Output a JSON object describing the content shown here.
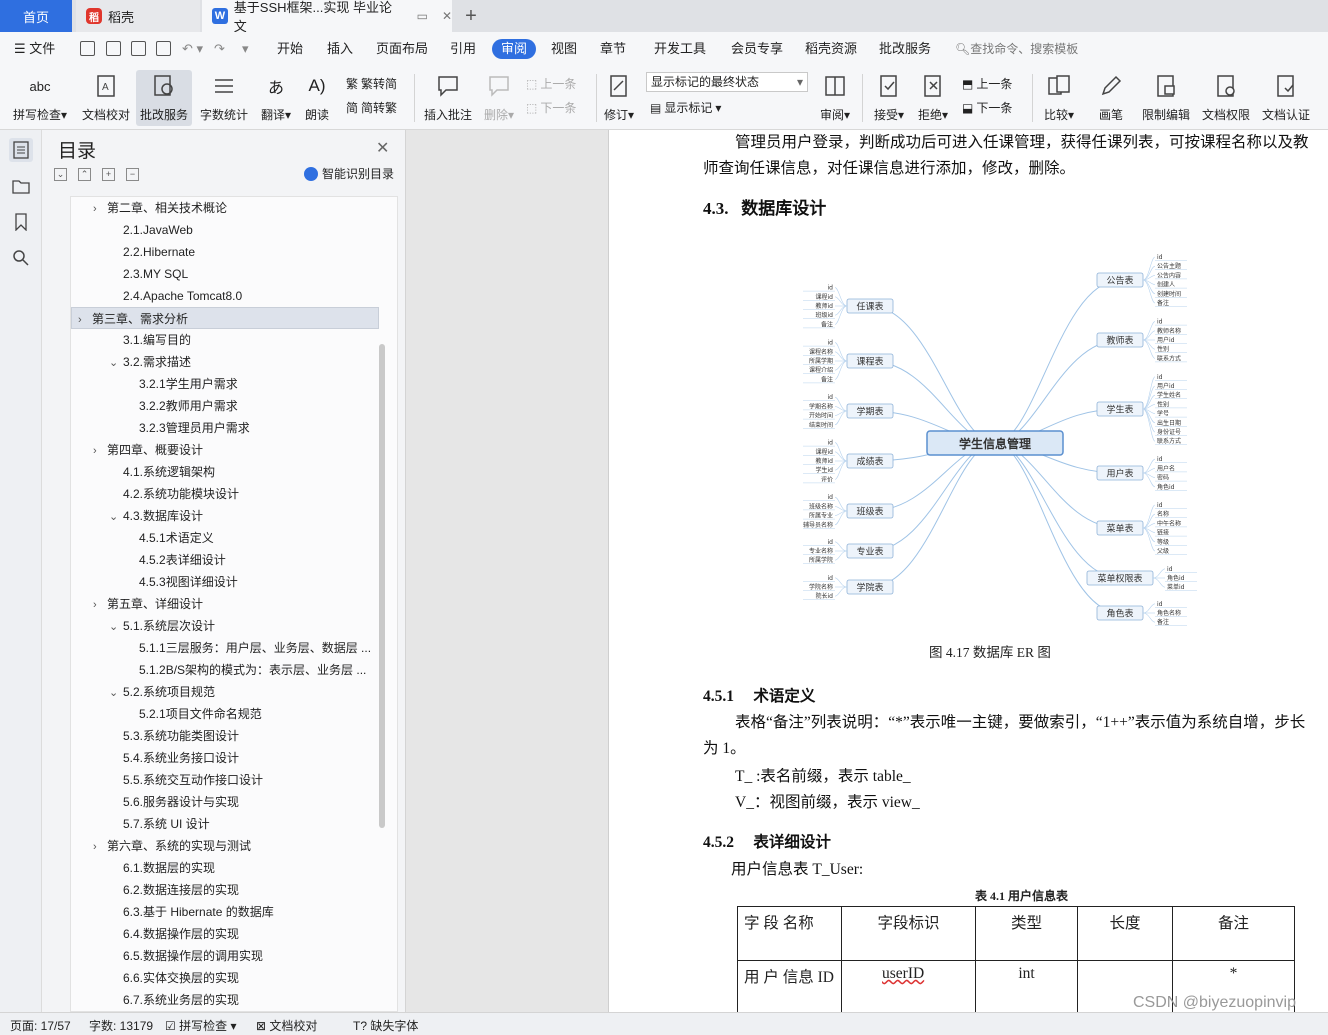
{
  "tabs": {
    "home": "首页",
    "daoke": "稻壳",
    "doc": "基于SSH框架...实现 毕业论文"
  },
  "menu": {
    "file": "文件",
    "items": [
      "开始",
      "插入",
      "页面布局",
      "引用",
      "审阅",
      "视图",
      "章节",
      "开发工具",
      "会员专享",
      "稻壳资源",
      "批改服务"
    ],
    "active": "审阅",
    "search": "查找命令、搜索模板"
  },
  "ribbon": {
    "spell": "拼写检查",
    "doccheck": "文档校对",
    "correct": "批改服务",
    "wordcount": "字数统计",
    "translate": "翻译",
    "read": "朗读",
    "trad": "繁转简",
    "simp": "简转繁",
    "insert_comment": "插入批注",
    "delete": "删除",
    "prev": "上一条",
    "next": "下一条",
    "track": "修订",
    "markup_state": "显示标记的最终状态",
    "show_markup": "显示标记",
    "review": "审阅",
    "accept": "接受",
    "reject": "拒绝",
    "prev2": "上一条",
    "next2": "下一条",
    "compare": "比较",
    "pen": "画笔",
    "restrict": "限制编辑",
    "perm": "文档权限",
    "cert": "文档认证",
    "abc": "abc"
  },
  "toc": {
    "title": "目录",
    "smart": "智能识别目录",
    "items": [
      {
        "text": "第二章、相关技术概论",
        "level": 1,
        "arrow": "›"
      },
      {
        "text": "2.1.JavaWeb",
        "level": 2,
        "arrow": ""
      },
      {
        "text": "2.2.Hibernate",
        "level": 2,
        "arrow": ""
      },
      {
        "text": "2.3.MY SQL",
        "level": 2,
        "arrow": ""
      },
      {
        "text": "2.4.Apache Tomcat8.0",
        "level": 2,
        "arrow": ""
      },
      {
        "text": "第三章、需求分析",
        "level": 0,
        "arrow": "›"
      },
      {
        "text": "3.1.编写目的",
        "level": 2,
        "arrow": ""
      },
      {
        "text": "3.2.需求描述",
        "level": 1.5,
        "arrow": "⌄"
      },
      {
        "text": "3.2.1学生用户需求",
        "level": 3,
        "arrow": ""
      },
      {
        "text": "3.2.2教师用户需求",
        "level": 3,
        "arrow": ""
      },
      {
        "text": "3.2.3管理员用户需求",
        "level": 3,
        "arrow": ""
      },
      {
        "text": "第四章、概要设计",
        "level": 1,
        "arrow": "›"
      },
      {
        "text": "4.1.系统逻辑架构",
        "level": 2,
        "arrow": ""
      },
      {
        "text": "4.2.系统功能模块设计",
        "level": 2,
        "arrow": ""
      },
      {
        "text": "4.3.数据库设计",
        "level": 1.5,
        "arrow": "⌄"
      },
      {
        "text": "4.5.1术语定义",
        "level": 3,
        "arrow": ""
      },
      {
        "text": "4.5.2表详细设计",
        "level": 3,
        "arrow": ""
      },
      {
        "text": "4.5.3视图详细设计",
        "level": 3,
        "arrow": ""
      },
      {
        "text": "第五章、详细设计",
        "level": 1,
        "arrow": "›"
      },
      {
        "text": "5.1.系统层次设计",
        "level": 1.5,
        "arrow": "⌄"
      },
      {
        "text": "5.1.1三层服务：用户层、业务层、数据层 ...",
        "level": 3,
        "arrow": ""
      },
      {
        "text": "5.1.2B/S架构的模式为：表示层、业务层 ...",
        "level": 3,
        "arrow": ""
      },
      {
        "text": "5.2.系统项目规范",
        "level": 1.5,
        "arrow": "⌄"
      },
      {
        "text": "5.2.1项目文件命名规范",
        "level": 3,
        "arrow": ""
      },
      {
        "text": "5.3.系统功能类图设计",
        "level": 2,
        "arrow": ""
      },
      {
        "text": "5.4.系统业务接口设计",
        "level": 2,
        "arrow": ""
      },
      {
        "text": "5.5.系统交互动作接口设计",
        "level": 2,
        "arrow": ""
      },
      {
        "text": "5.6.服务器设计与实现",
        "level": 2,
        "arrow": ""
      },
      {
        "text": "5.7.系统 UI 设计",
        "level": 2,
        "arrow": ""
      },
      {
        "text": "第六章、系统的实现与测试",
        "level": 1,
        "arrow": "›"
      },
      {
        "text": "6.1.数据层的实现",
        "level": 2,
        "arrow": ""
      },
      {
        "text": "6.2.数据连接层的实现",
        "level": 2,
        "arrow": ""
      },
      {
        "text": "6.3.基于 Hibernate 的数据库",
        "level": 2,
        "arrow": ""
      },
      {
        "text": "6.4.数据操作层的实现",
        "level": 2,
        "arrow": ""
      },
      {
        "text": "6.5.数据操作层的调用实现",
        "level": 2,
        "arrow": ""
      },
      {
        "text": "6.6.实体交换层的实现",
        "level": 2,
        "arrow": ""
      },
      {
        "text": "6.7.系统业务层的实现",
        "level": 2,
        "arrow": ""
      }
    ]
  },
  "doc": {
    "line1": "管理员用户登录，判断成功后可进入任课管理，获得任课列表，可按课程名称以及教",
    "line2": "师查询任课信息，对任课信息进行添加，修改，删除。",
    "h43_num": "4.3.",
    "h43": "数据库设计",
    "fig_caption": "图 4.17 数据库 ER 图",
    "h451_num": "4.5.1",
    "h451": "术语定义",
    "p1a": "表格“备注”列表说明：“*”表示唯一主键，要做索引，“1++”表示值为系统自增，步长",
    "p1b": "为 1。",
    "p2": "T_ :表名前缀，表示 table_",
    "p3": "V_：视图前缀，表示 view_",
    "h452_num": "4.5.2",
    "h452": "表详细设计",
    "p4": "用户信息表 T_User:",
    "table_caption": "表 4.1  用户信息表",
    "table_headers": [
      "字 段 名称",
      "字段标识",
      "类型",
      "长度",
      "备注"
    ],
    "table_rows": [
      [
        "用 户 信息 ID",
        "userID",
        "int",
        "",
        "*"
      ]
    ]
  },
  "er": {
    "center": "学生信息管理",
    "left": [
      {
        "name": "任课表",
        "fields": [
          "id",
          "课程id",
          "教师id",
          "班级id",
          "备注"
        ]
      },
      {
        "name": "课程表",
        "fields": [
          "id",
          "课程名称",
          "所属学期",
          "课程介绍",
          "备注"
        ]
      },
      {
        "name": "学期表",
        "fields": [
          "id",
          "学期名称",
          "开始时间",
          "结束时间"
        ]
      },
      {
        "name": "成绩表",
        "fields": [
          "id",
          "课程id",
          "教师id",
          "学生id",
          "评价"
        ]
      },
      {
        "name": "班级表",
        "fields": [
          "id",
          "班级名称",
          "所属专业",
          "辅导员名称"
        ]
      },
      {
        "name": "专业表",
        "fields": [
          "id",
          "专业名称",
          "所属学院"
        ]
      },
      {
        "name": "学院表",
        "fields": [
          "id",
          "学院名称",
          "院长id"
        ]
      }
    ],
    "right": [
      {
        "name": "公告表",
        "fields": [
          "id",
          "公告主题",
          "公告内容",
          "创建人",
          "创建时间",
          "备注"
        ]
      },
      {
        "name": "教师表",
        "fields": [
          "id",
          "教师名称",
          "用户id",
          "性别",
          "联系方式"
        ]
      },
      {
        "name": "学生表",
        "fields": [
          "id",
          "用户id",
          "学生姓名",
          "性别",
          "学号",
          "出生日期",
          "身份证号",
          "联系方式"
        ]
      },
      {
        "name": "用户表",
        "fields": [
          "id",
          "用户名",
          "密码",
          "角色id"
        ]
      },
      {
        "name": "菜单表",
        "fields": [
          "id",
          "名称",
          "中午名称",
          "链接",
          "等级",
          "父级"
        ]
      },
      {
        "name": "菜单权限表",
        "fields": [
          "id",
          "角色id",
          "菜单id"
        ]
      },
      {
        "name": "角色表",
        "fields": [
          "id",
          "角色名称",
          "备注"
        ]
      }
    ]
  },
  "status": {
    "page": "页面: 17/57",
    "words": "字数: 13179",
    "spell": "拼写检查",
    "check": "文档校对",
    "font": "缺失字体"
  },
  "watermark": "CSDN @biyezuopinvip"
}
